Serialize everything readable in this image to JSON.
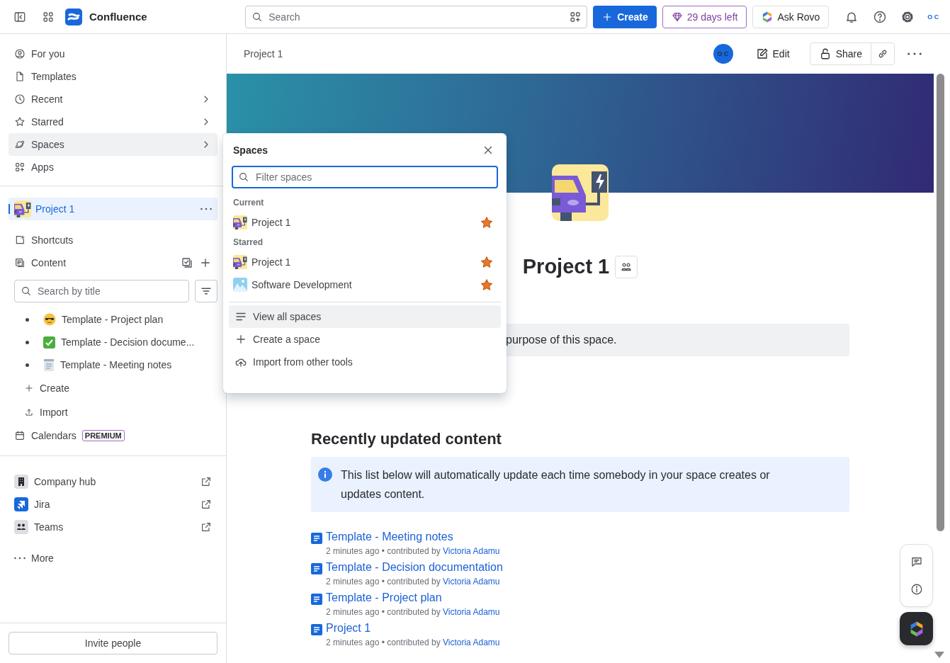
{
  "top_bar": {
    "app_name": "Confluence",
    "search": {
      "placeholder": "Search"
    },
    "create_button": "Create",
    "trial_badge": "29 days left",
    "ask_button": "Ask Rovo",
    "avatar_initials": "O C"
  },
  "sidebar": {
    "nav": [
      {
        "label": "For you",
        "kind": "person",
        "submenu": false,
        "selected": false
      },
      {
        "label": "Templates",
        "kind": "document",
        "submenu": false,
        "selected": false
      },
      {
        "label": "Recent",
        "kind": "clock",
        "submenu": true,
        "selected": false
      },
      {
        "label": "Starred",
        "kind": "star",
        "submenu": true,
        "selected": false
      },
      {
        "label": "Spaces",
        "kind": "planet",
        "submenu": true,
        "selected": true
      },
      {
        "label": "Apps",
        "kind": "apps",
        "submenu": false,
        "selected": false
      }
    ],
    "space": {
      "name": "Project 1",
      "selected": true
    },
    "space_items": [
      {
        "label": "Shortcuts",
        "kind": "shortcut"
      },
      {
        "label": "Content",
        "kind": "content"
      }
    ],
    "content_search": {
      "placeholder": "Search by title"
    },
    "tree": [
      {
        "title": "Template - Project plan",
        "kind": "sunglasses"
      },
      {
        "title": "Template - Decision docume...",
        "kind": "check"
      },
      {
        "title": "Template - Meeting notes",
        "kind": "notepad"
      }
    ],
    "tree_actions": [
      {
        "label": "Create",
        "kind": "plus"
      },
      {
        "label": "Import",
        "kind": "upload"
      }
    ],
    "calendars": {
      "label": "Calendars",
      "badge": "PREMIUM"
    },
    "apps": [
      {
        "label": "Company hub",
        "kind": "building"
      },
      {
        "label": "Jira",
        "kind": "jira"
      },
      {
        "label": "Teams",
        "kind": "teams"
      }
    ],
    "more": "More",
    "invite_button": "Invite people"
  },
  "page_header": {
    "breadcrumb": "Project 1",
    "avatar_initials": "O C",
    "edit_button": "Edit",
    "share_button": "Share"
  },
  "page": {
    "title": "Project 1",
    "note": "purpose of this space.",
    "section_title": "Recently updated content",
    "info": "This list below will automatically update each time somebody in your space creates or updates content.",
    "updates": [
      {
        "title": "Template - Meeting notes",
        "meta": "2 minutes ago • contributed by",
        "author": "Victoria Adamu"
      },
      {
        "title": "Template - Decision documentation",
        "meta": "2 minutes ago • contributed by",
        "author": "Victoria Adamu"
      },
      {
        "title": "Template - Project plan",
        "meta": "2 minutes ago • contributed by",
        "author": "Victoria Adamu"
      },
      {
        "title": "Project 1",
        "meta": "2 minutes ago • contributed by",
        "author": "Victoria Adamu"
      }
    ]
  },
  "spaces_popover": {
    "title": "Spaces",
    "filter": {
      "placeholder": "Filter spaces"
    },
    "groups": [
      {
        "heading": "Current",
        "items": [
          {
            "name": "Project 1",
            "kind": "car",
            "starred": true
          }
        ]
      },
      {
        "heading": "Starred",
        "items": [
          {
            "name": "Project 1",
            "kind": "car",
            "starred": true
          },
          {
            "name": "Software Development",
            "kind": "mountains",
            "starred": true
          }
        ]
      }
    ],
    "actions": [
      {
        "label": "View all spaces",
        "kind": "list",
        "selected": true
      },
      {
        "label": "Create a space",
        "kind": "plus",
        "selected": false
      },
      {
        "label": "Import from other tools",
        "kind": "cloud",
        "selected": false
      }
    ]
  }
}
